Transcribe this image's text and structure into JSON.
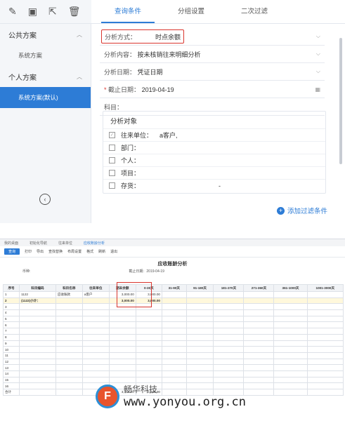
{
  "toolbar": {
    "icons": [
      "edit-icon",
      "save-icon",
      "export-icon",
      "delete-icon"
    ]
  },
  "tabs": [
    {
      "label": "查询条件"
    },
    {
      "label": "分组设置"
    },
    {
      "label": "二次过滤"
    }
  ],
  "sidebar": {
    "groups": [
      {
        "label": "公共方案",
        "items": [
          {
            "label": "系统方案"
          }
        ]
      },
      {
        "label": "个人方案",
        "items": [
          {
            "label": "系统方案(默认)"
          }
        ]
      }
    ]
  },
  "form": {
    "analysis_method": {
      "label": "分析方式：",
      "value": "时点余额"
    },
    "analysis_content": {
      "label": "分析内容：",
      "value": "按未核销往来明细分析"
    },
    "analysis_date": {
      "label": "分析日期：",
      "value": "凭证日期"
    },
    "cutoff_date": {
      "required": "*",
      "label": "截止日期：",
      "value": "2019-04-19"
    },
    "subject": {
      "label": "科目："
    }
  },
  "targets": {
    "title": "分析对象",
    "rows": [
      {
        "label": "往来单位：",
        "value": "a客户,",
        "checked": "✓"
      },
      {
        "label": "部门：",
        "value": ""
      },
      {
        "label": "个人：",
        "value": ""
      },
      {
        "label": "项目：",
        "value": ""
      },
      {
        "label": "存货：",
        "value": "-"
      }
    ]
  },
  "add_filter": "添加过滤条件",
  "report": {
    "tabs": [
      "我的桌面",
      "初始化导航",
      "往来单位",
      "应收账龄分析"
    ],
    "toolbar": [
      "查询",
      "打印",
      "导出",
      "查找替换",
      "布局设置",
      "格式",
      "刷新",
      "退出"
    ],
    "title": "应收账龄分析",
    "currency_label": "币种:",
    "date_label": "截止日期：2019-04-19",
    "columns": [
      "序号",
      "科目编码",
      "科目名称",
      "往来单位",
      "期末余额",
      "0-30天",
      "31-90天",
      "91-180天",
      "181-270天",
      "271-360天",
      "361-1000天",
      "1001-3000天"
    ],
    "rows": [
      [
        "1",
        "1122",
        "应收账款",
        "a客户",
        "3,000.00",
        "3,000.00",
        "",
        "",
        "",
        "",
        "",
        ""
      ],
      [
        "2",
        "(1122)小计：",
        "",
        "",
        "3,000.00",
        "3,000.00",
        "",
        "",
        "",
        "",
        "",
        ""
      ]
    ],
    "empty_rows": [
      "3",
      "4",
      "5",
      "6",
      "7",
      "8",
      "9",
      "10",
      "11",
      "12",
      "13",
      "14",
      "15",
      "16"
    ],
    "total_label": "合计",
    "total_values": [
      "3,000.00",
      "3,000.00"
    ]
  },
  "watermark": {
    "line1": "畅华科技",
    "line2": "www.yonyou.org.cn"
  }
}
